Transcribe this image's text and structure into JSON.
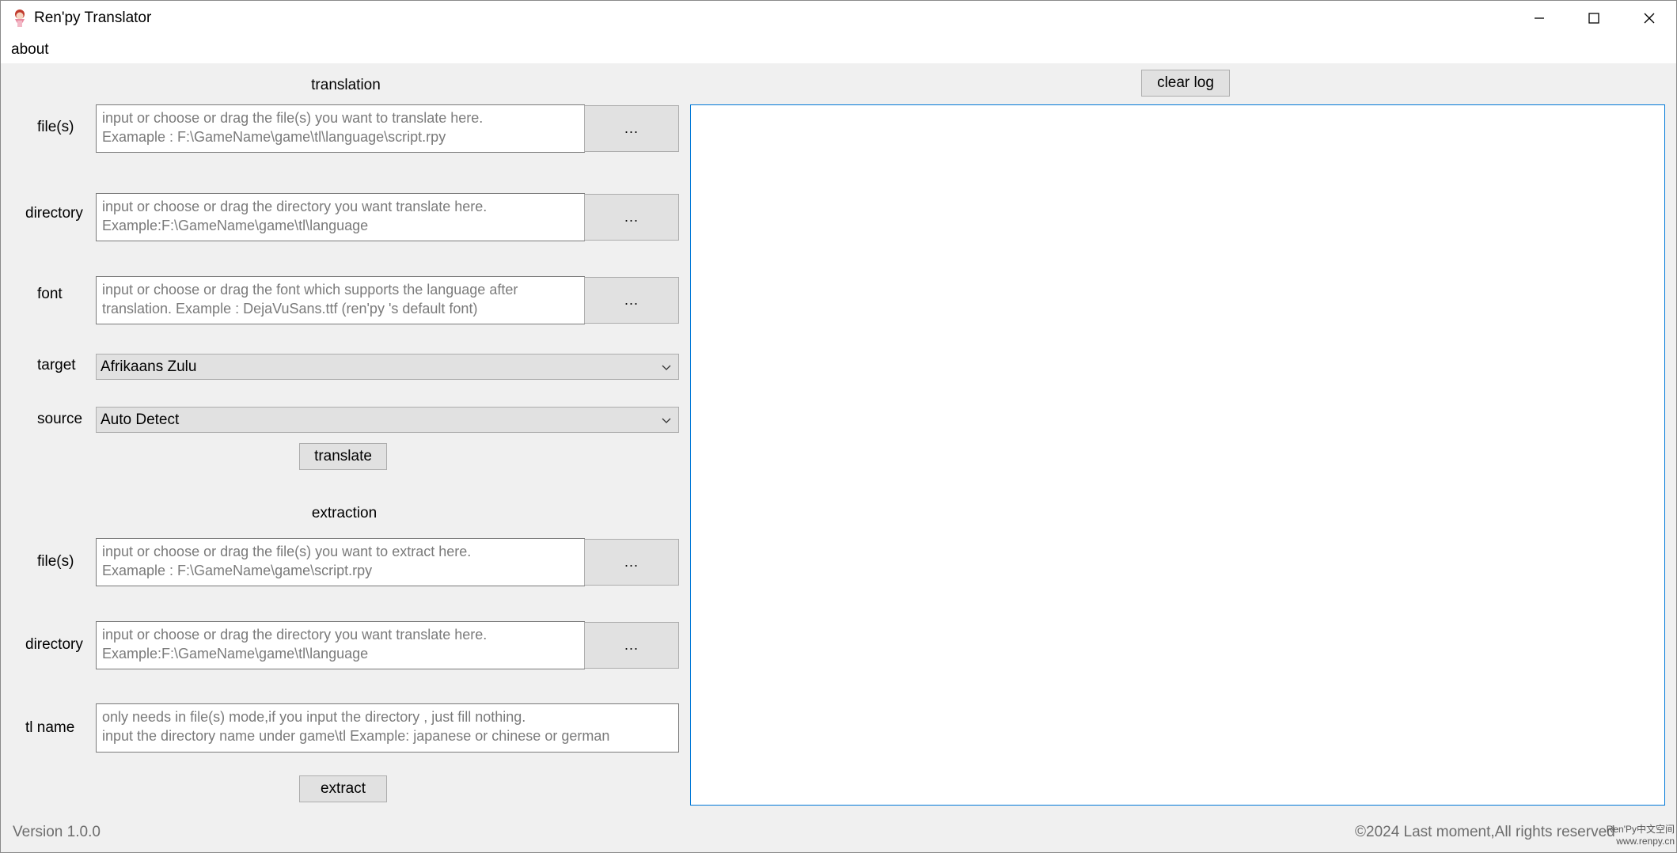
{
  "window": {
    "title": "Ren'py Translator"
  },
  "menu": {
    "about": "about"
  },
  "translation": {
    "title": "translation",
    "files_label": "file(s)",
    "files_placeholder": "input or choose or drag the file(s) you want to translate here.\nExamaple : F:\\GameName\\game\\tl\\language\\script.rpy",
    "directory_label": "directory",
    "directory_placeholder": "input or choose or drag the directory you want translate here.\nExample:F:\\GameName\\game\\tl\\language",
    "font_label": "font",
    "font_placeholder": "input or choose or drag the font which supports the language after\ntranslation. Example : DejaVuSans.ttf (ren'py 's default font)",
    "browse_label": "...",
    "target_label": "target",
    "target_value": "Afrikaans Zulu",
    "source_label": "source",
    "source_value": "Auto Detect",
    "translate_button": "translate"
  },
  "extraction": {
    "title": "extraction",
    "files_label": "file(s)",
    "files_placeholder": "input or choose or drag the file(s) you want to extract here.\nExamaple : F:\\GameName\\game\\script.rpy",
    "directory_label": "directory",
    "directory_placeholder": "input or choose or drag the directory you want translate here.\nExample:F:\\GameName\\game\\tl\\language",
    "browse_label": "...",
    "tlname_label": "tl name",
    "tlname_placeholder": "only needs in file(s) mode,if you input the directory , just fill nothing.\ninput the directory name under game\\tl  Example: japanese or chinese  or  german",
    "extract_button": "extract"
  },
  "log": {
    "clear_button": "clear log"
  },
  "status": {
    "version": "Version 1.0.0",
    "copyright": "©2024 Last moment,All rights reserved",
    "watermark_line1": "Ren'Py中文空间",
    "watermark_line2": "www.renpy.cn"
  },
  "icons": {
    "app": "renpy-girl-icon",
    "minimize": "minimize-icon",
    "maximize": "maximize-icon",
    "close": "close-icon",
    "dropdown": "chevron-down-icon"
  }
}
